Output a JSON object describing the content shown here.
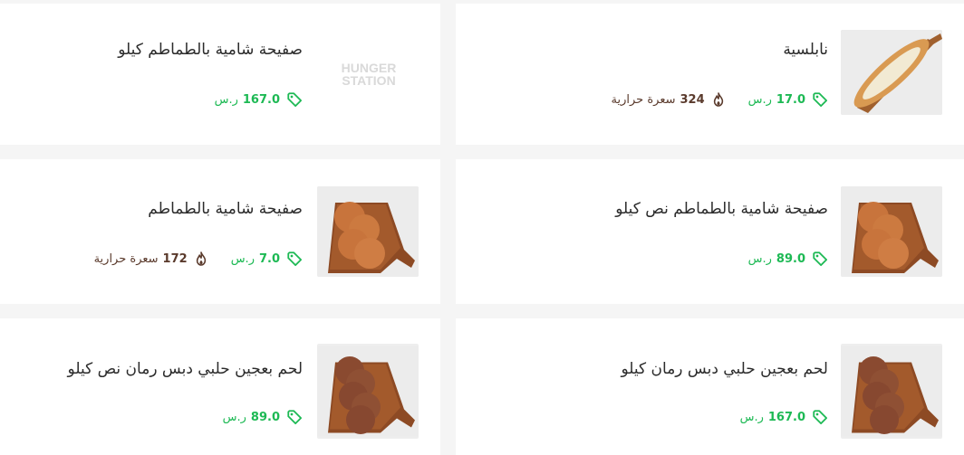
{
  "currency": "ر.س",
  "calorie_unit": "سعرة حرارية",
  "logo_text": [
    "HUNGER",
    "STATION"
  ],
  "colors": {
    "price": "#1db954",
    "calories": "#5a3a2c",
    "name": "#2b2b2b"
  },
  "items": [
    {
      "name": "نابلسية",
      "price": "17.0",
      "calories": "324",
      "image": "nabulsia-pie-icon"
    },
    {
      "name": "صفيحة شامية بالطماطم كيلو",
      "price": "167.0",
      "calories": null,
      "image": "hungerstation-placeholder-logo"
    },
    {
      "name": "صفيحة شامية بالطماطم نص كيلو",
      "price": "89.0",
      "calories": null,
      "image": "sfiha-board-icon"
    },
    {
      "name": "صفيحة شامية بالطماطم",
      "price": "7.0",
      "calories": "172",
      "image": "sfiha-board-icon"
    },
    {
      "name": "لحم بعجين حلبي دبس رمان كيلو",
      "price": "167.0",
      "calories": null,
      "image": "lahm-bajeen-board-icon"
    },
    {
      "name": "لحم بعجين حلبي دبس رمان نص كيلو",
      "price": "89.0",
      "calories": null,
      "image": "lahm-bajeen-board-icon"
    }
  ]
}
